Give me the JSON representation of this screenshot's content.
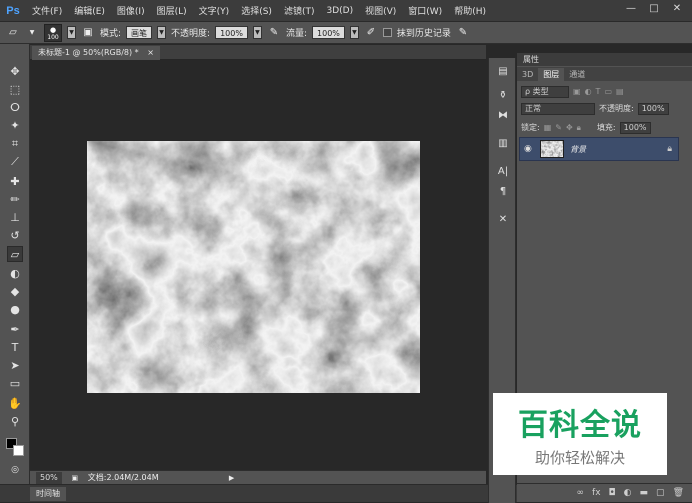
{
  "app": {
    "logo": "Ps"
  },
  "menu": [
    "文件(F)",
    "编辑(E)",
    "图像(I)",
    "图层(L)",
    "文字(Y)",
    "选择(S)",
    "滤镜(T)",
    "3D(D)",
    "视图(V)",
    "窗口(W)",
    "帮助(H)"
  ],
  "window_controls": {
    "minimize": "—",
    "restore": "□",
    "close": "✕"
  },
  "options": {
    "brush_size": "100",
    "mode_label": "模式:",
    "mode_value": "画笔",
    "opacity_label": "不透明度:",
    "opacity_value": "100%",
    "flow_label": "流量:",
    "flow_value": "100%",
    "history_label": "抹到历史记录"
  },
  "document": {
    "tab_title": "未标题-1 @ 50%(RGB/8) *",
    "tab_close": "×"
  },
  "status": {
    "zoom": "50%",
    "doc_info": "文档:2.04M/2.04M"
  },
  "timeline": {
    "label": "时间轴"
  },
  "panels": {
    "properties_label": "属性",
    "tabs": [
      "3D",
      "图层",
      "通道"
    ],
    "active_tab": "图层",
    "filter_kind": "ρ 类型",
    "blend_mode": "正常",
    "opacity_label": "不透明度:",
    "opacity_value": "100%",
    "lock_label": "锁定:",
    "fill_label": "填充:",
    "fill_value": "100%",
    "layer_name": "背景"
  },
  "watermark": {
    "title": "百科全说",
    "subtitle": "助你轻松解决"
  },
  "colors": {
    "accent": "#4ea3ff",
    "watermark_green": "#19a15f",
    "layer_selected": "#3d4d6b"
  },
  "icons": {
    "tools": [
      "move-icon",
      "marquee-icon",
      "lasso-icon",
      "quick-select-icon",
      "crop-icon",
      "eyedropper-icon",
      "healing-icon",
      "brush-icon",
      "stamp-icon",
      "history-brush-icon",
      "eraser-icon",
      "gradient-icon",
      "blur-icon",
      "dodge-icon",
      "pen-icon",
      "type-icon",
      "path-select-icon",
      "shape-icon",
      "hand-icon",
      "zoom-icon"
    ]
  }
}
